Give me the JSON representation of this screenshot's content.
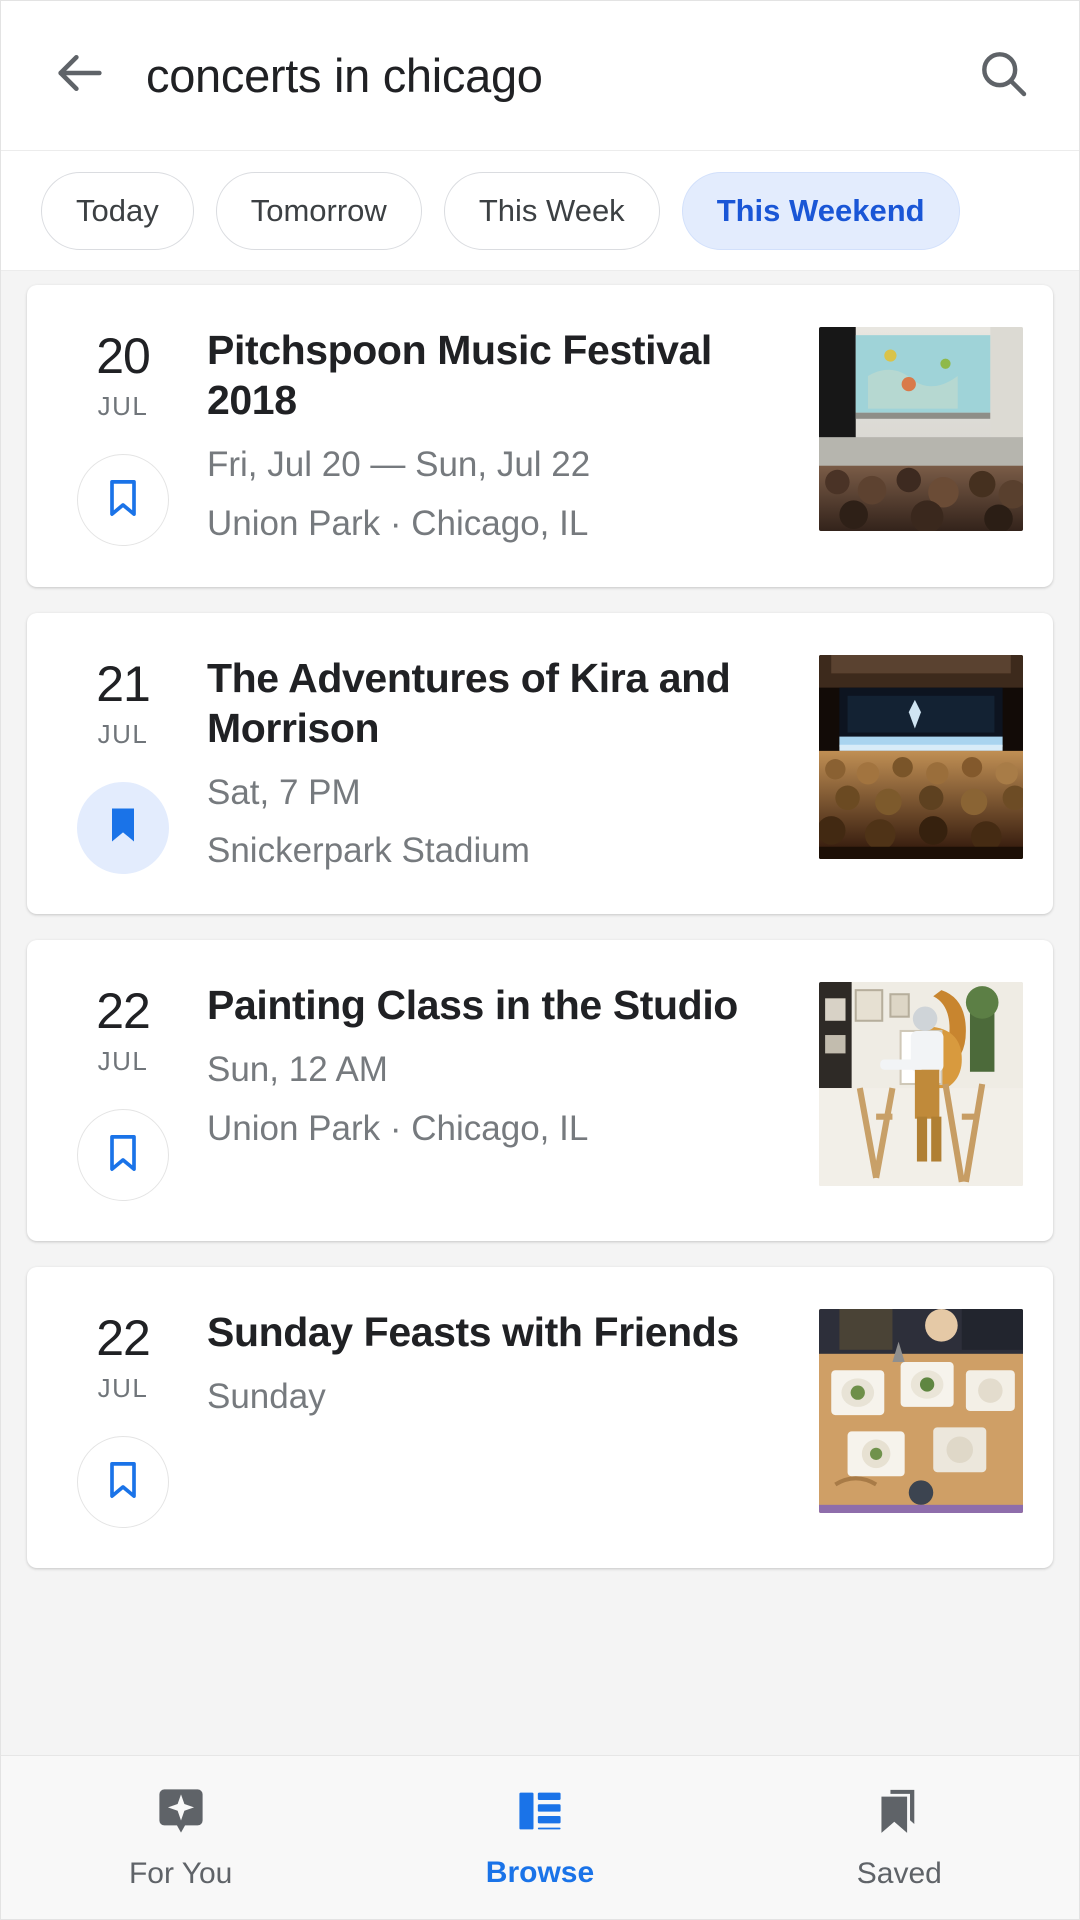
{
  "colors": {
    "accent_blue": "#1a73e8",
    "chip_selected_bg": "#e3ecfd",
    "chip_selected_text": "#1a56d6",
    "text_primary": "#202124",
    "text_secondary": "#767a7e",
    "page_bg": "#f4f4f4",
    "card_bg": "#ffffff",
    "nav_bg": "#f8f8f8"
  },
  "search": {
    "back_icon": "back-arrow-icon",
    "query": "concerts in chicago",
    "placeholder": "Search",
    "search_icon": "search-icon"
  },
  "chips": [
    {
      "label": "Today",
      "selected": false
    },
    {
      "label": "Tomorrow",
      "selected": false
    },
    {
      "label": "This Week",
      "selected": false
    },
    {
      "label": "This Weekend",
      "selected": true
    }
  ],
  "events": [
    {
      "day": "20",
      "month": "JUL",
      "title": "Pitchspoon Music Festival 2018",
      "date_line": "Fri, Jul 20 — Sun, Jul 22",
      "venue_line": "Union Park · Chicago, IL",
      "saved": false,
      "bookmark_icon": "bookmark-outline-icon",
      "thumbnail": "music-festival-crowd-stage-photo"
    },
    {
      "day": "21",
      "month": "JUL",
      "title": "The Adventures of Kira and Morrison",
      "date_line": "Sat, 7 PM",
      "venue_line": "Snickerpark Stadium",
      "saved": true,
      "bookmark_icon": "bookmark-filled-icon",
      "thumbnail": "theater-audience-stage-photo"
    },
    {
      "day": "22",
      "month": "JUL",
      "title": "Painting Class in the Studio",
      "date_line": "Sun, 12 AM",
      "venue_line": "Union Park · Chicago, IL",
      "saved": false,
      "bookmark_icon": "bookmark-outline-icon",
      "thumbnail": "painter-at-easel-studio-photo"
    },
    {
      "day": "22",
      "month": "JUL",
      "title": "Sunday Feasts with Friends",
      "date_line": "Sunday",
      "venue_line": "",
      "saved": false,
      "bookmark_icon": "bookmark-outline-icon",
      "thumbnail": "dinner-table-food-overhead-photo"
    }
  ],
  "bottom_nav": [
    {
      "label": "For You",
      "icon": "for-you-sparkle-icon",
      "active": false
    },
    {
      "label": "Browse",
      "icon": "browse-list-icon",
      "active": true
    },
    {
      "label": "Saved",
      "icon": "saved-bookmarks-icon",
      "active": false
    }
  ]
}
